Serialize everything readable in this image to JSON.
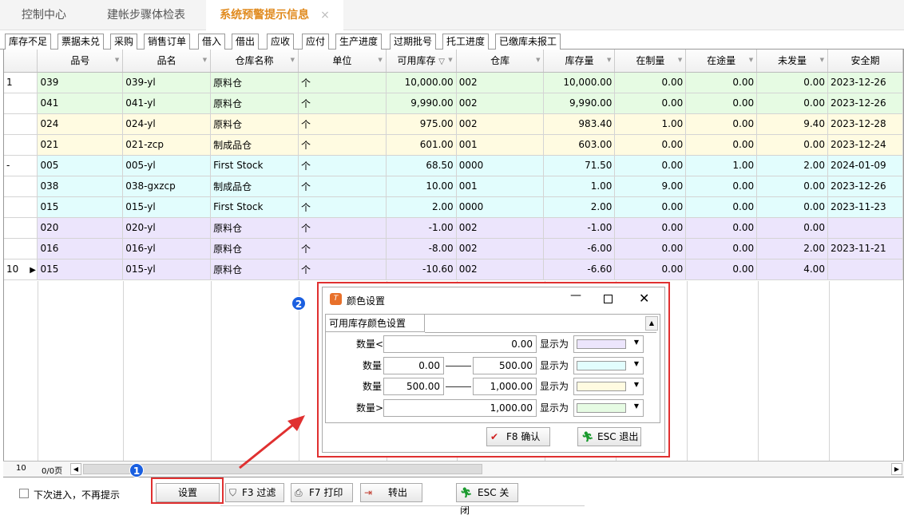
{
  "top_tabs": [
    "控制中心",
    "建帐步骤体检表",
    "系统预警提示信息"
  ],
  "close_glyph": "×",
  "sub_tabs": [
    "库存不足",
    "票据未兑",
    "采购",
    "销售订单",
    "借入",
    "借出",
    "应收",
    "应付",
    "生产进度",
    "过期批号",
    "托工进度",
    "已缴库未报工"
  ],
  "columns": [
    "品号",
    "品名",
    "仓库名称",
    "单位",
    "可用库存",
    "仓库",
    "库存量",
    "在制量",
    "在途量",
    "未发量",
    "安全期"
  ],
  "sort_indicator": "▽",
  "rows": [
    {
      "idx": "1",
      "cells": [
        "039",
        "039-yl",
        "原料仓",
        "个",
        "10,000.00",
        "002",
        "10,000.00",
        "0.00",
        "0.00",
        "0.00",
        "2023-12-26"
      ]
    },
    {
      "idx": "",
      "cells": [
        "041",
        "041-yl",
        "原料仓",
        "个",
        "9,990.00",
        "002",
        "9,990.00",
        "0.00",
        "0.00",
        "0.00",
        "2023-12-26"
      ]
    },
    {
      "idx": "",
      "cells": [
        "024",
        "024-yl",
        "原料仓",
        "个",
        "975.00",
        "002",
        "983.40",
        "1.00",
        "0.00",
        "9.40",
        "2023-12-28"
      ]
    },
    {
      "idx": "",
      "cells": [
        "021",
        "021-zcp",
        "制成品仓",
        "个",
        "601.00",
        "001",
        "603.00",
        "0.00",
        "0.00",
        "0.00",
        "2023-12-24"
      ]
    },
    {
      "idx": "-",
      "cells": [
        "005",
        "005-yl",
        "First Stock",
        "个",
        "68.50",
        "0000",
        "71.50",
        "0.00",
        "1.00",
        "2.00",
        "2024-01-09"
      ]
    },
    {
      "idx": "",
      "cells": [
        "038",
        "038-gxzcp",
        "制成品仓",
        "个",
        "10.00",
        "001",
        "1.00",
        "9.00",
        "0.00",
        "0.00",
        "2023-12-26"
      ]
    },
    {
      "idx": "",
      "cells": [
        "015",
        "015-yl",
        "First Stock",
        "个",
        "2.00",
        "0000",
        "2.00",
        "0.00",
        "0.00",
        "0.00",
        "2023-11-23"
      ]
    },
    {
      "idx": "",
      "cells": [
        "020",
        "020-yl",
        "原料仓",
        "个",
        "-1.00",
        "002",
        "-1.00",
        "0.00",
        "0.00",
        "0.00",
        ""
      ]
    },
    {
      "idx": "",
      "cells": [
        "016",
        "016-yl",
        "原料仓",
        "个",
        "-8.00",
        "002",
        "-6.00",
        "0.00",
        "0.00",
        "2.00",
        "2023-11-21"
      ]
    },
    {
      "idx": "10",
      "cells": [
        "015",
        "015-yl",
        "原料仓",
        "个",
        "-10.60",
        "002",
        "-6.60",
        "0.00",
        "0.00",
        "4.00",
        ""
      ]
    }
  ],
  "footer": {
    "count": "10",
    "page": "0/0页"
  },
  "bottom": {
    "no_prompt": "下次进入，不再提示",
    "settings": "设置",
    "filter": "F3 过滤",
    "print": "F7 打印",
    "export": "转出",
    "close": "ESC 关闭"
  },
  "dialog": {
    "title": "颜色设置",
    "tab": "可用库存颜色设置",
    "qty_label": "数量",
    "lt": "<",
    "gt": ">",
    "show_as": "显示为",
    "v_lt": "0.00",
    "r1_from": "0.00",
    "r1_to": "500.00",
    "r2_from": "500.00",
    "r2_to": "1,000.00",
    "v_gt": "1,000.00",
    "confirm": "F8 确认",
    "exit": "ESC 退出"
  },
  "badges": [
    "1",
    "2"
  ],
  "colors": {
    "green": "#e6fbe3",
    "yellow": "#fffbe1",
    "cyan": "#e2fdfd",
    "purple": "#ece5fc",
    "accent": "#e08a1e",
    "highlight": "#e03030",
    "badge": "#1a5fe0"
  }
}
